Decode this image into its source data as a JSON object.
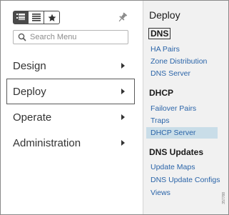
{
  "toolbar": {
    "tabs": [
      {
        "icon": "list-detailed-icon",
        "active": true
      },
      {
        "icon": "list-icon",
        "active": false
      },
      {
        "icon": "star-icon",
        "active": false
      }
    ],
    "pin_icon": "pin-icon"
  },
  "search": {
    "placeholder": "Search Menu",
    "icon": "search-icon"
  },
  "menu": {
    "items": [
      {
        "label": "Design",
        "selected": false
      },
      {
        "label": "Deploy",
        "selected": true
      },
      {
        "label": "Operate",
        "selected": false
      },
      {
        "label": "Administration",
        "selected": false
      }
    ]
  },
  "submenu": {
    "title": "Deploy",
    "sections": [
      {
        "heading": "DNS",
        "links": [
          "HA Pairs",
          "Zone Distribution",
          "DNS Server"
        ]
      },
      {
        "heading": "DHCP",
        "links": [
          "Failover Pairs",
          "Traps",
          "DHCP Server"
        ]
      },
      {
        "heading": "DNS Updates",
        "links": [
          "Update Maps",
          "DNS Update Configs",
          "Views"
        ]
      }
    ],
    "active_link": "DHCP Server",
    "figure_id": "357788"
  },
  "colors": {
    "link": "#2a64a8",
    "active_link_bg": "#c9dde8",
    "panel_bg": "#f1f1f1",
    "text": "#333333"
  }
}
